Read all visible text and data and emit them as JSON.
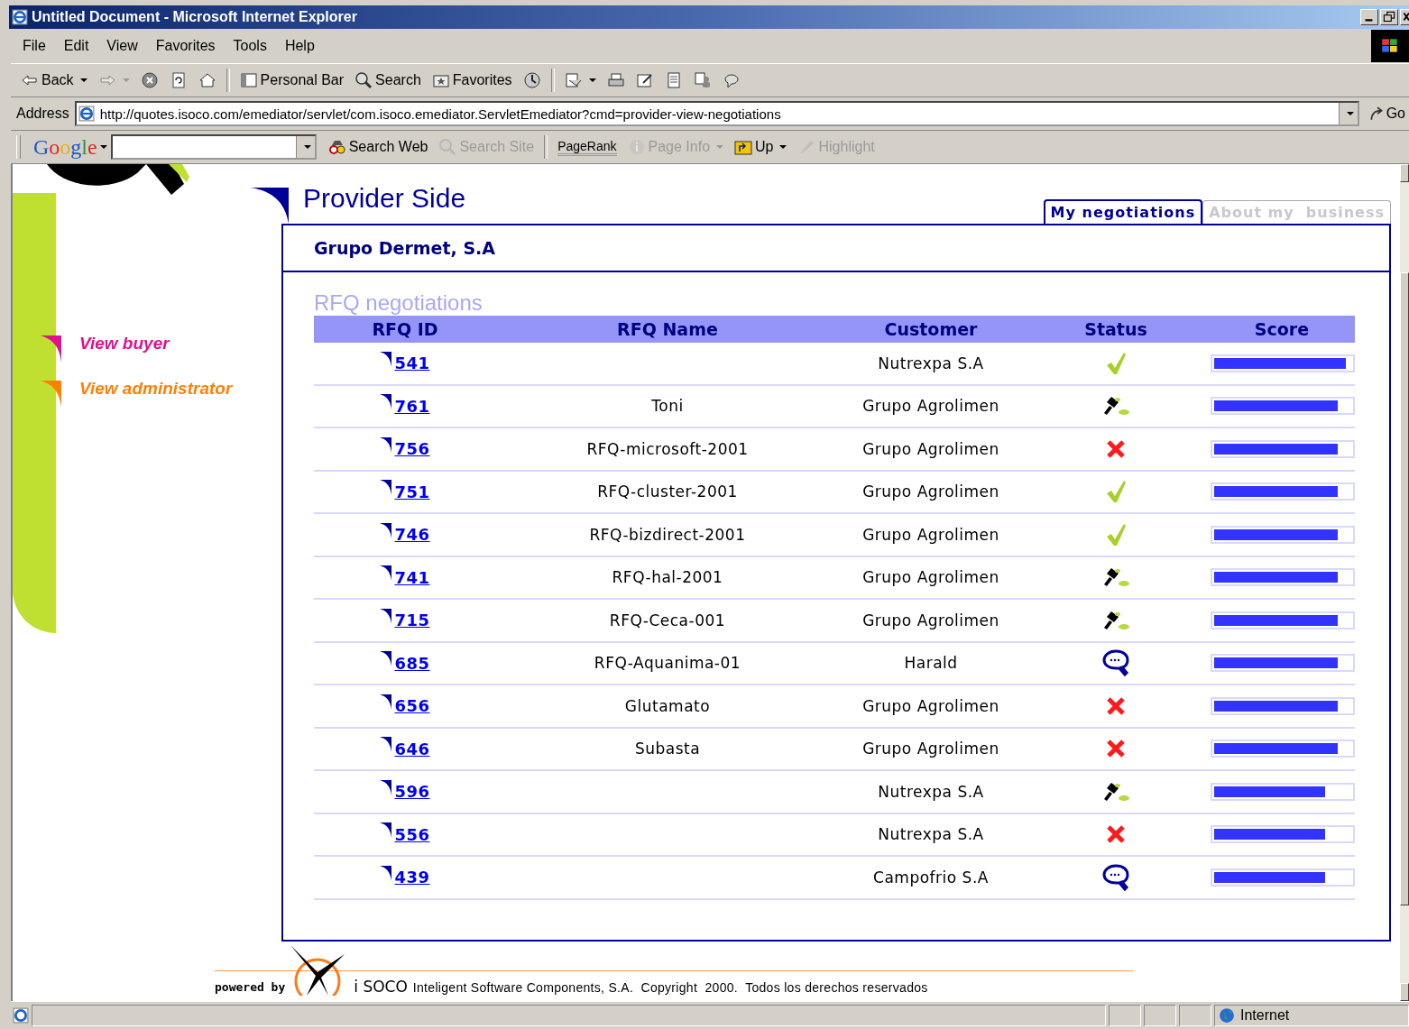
{
  "window": {
    "title": "Untitled Document - Microsoft Internet Explorer"
  },
  "menu": [
    "File",
    "Edit",
    "View",
    "Favorites",
    "Tools",
    "Help"
  ],
  "toolbar": {
    "groups": [
      [
        {
          "kind": "back",
          "label": "Back",
          "dropdown": true,
          "disabled": false
        },
        {
          "kind": "forward",
          "dropdown": true,
          "disabled": true
        },
        {
          "kind": "stop",
          "dropdown": false,
          "disabled": false
        },
        {
          "kind": "refresh",
          "dropdown": false,
          "disabled": false
        },
        {
          "kind": "home",
          "dropdown": false,
          "disabled": false
        }
      ],
      [
        {
          "kind": "personal-bar",
          "label": "Personal Bar",
          "dropdown": false,
          "disabled": false
        },
        {
          "kind": "search",
          "label": "Search",
          "dropdown": false,
          "disabled": false
        },
        {
          "kind": "favorites",
          "label": "Favorites",
          "dropdown": false,
          "disabled": false
        },
        {
          "kind": "history",
          "dropdown": false,
          "disabled": false
        }
      ],
      [
        {
          "kind": "mail",
          "dropdown": true,
          "disabled": false
        },
        {
          "kind": "print",
          "dropdown": false,
          "disabled": false
        },
        {
          "kind": "edit",
          "dropdown": false,
          "disabled": false
        },
        {
          "kind": "discuss",
          "dropdown": false,
          "disabled": false
        },
        {
          "kind": "messenger",
          "dropdown": false,
          "disabled": false
        },
        {
          "kind": "chat",
          "dropdown": false,
          "disabled": false
        }
      ]
    ]
  },
  "address": {
    "label": "Address",
    "url": "http://quotes.isoco.com/emediator/servlet/com.isoco.emediator.ServletEmediator?cmd=provider-view-negotiations",
    "go": "Go"
  },
  "google_bar": {
    "logo": "Google",
    "items": [
      {
        "kind": "search-web",
        "label": "Search Web",
        "dropdown": false,
        "disabled": false
      },
      {
        "kind": "search-site",
        "label": "Search Site",
        "dropdown": false,
        "disabled": true
      },
      {
        "kind": "pagerank",
        "label": "PageRank",
        "dropdown": false,
        "disabled": false
      },
      {
        "kind": "page-info",
        "label": "Page Info",
        "dropdown": true,
        "disabled": true
      },
      {
        "kind": "up",
        "label": "Up",
        "dropdown": true,
        "disabled": false
      },
      {
        "kind": "highlight",
        "label": "Highlight",
        "dropdown": false,
        "disabled": true
      }
    ]
  },
  "sidebar": {
    "links": [
      {
        "label": "View buyer",
        "color": "#e0108f"
      },
      {
        "label": "View administrator",
        "color": "#ff8000"
      }
    ]
  },
  "page": {
    "title": "Provider Side",
    "tabs": [
      {
        "label": "My negotiations",
        "selected": true
      },
      {
        "label": "About my  business",
        "selected": false
      }
    ],
    "company": "Grupo Dermet, S.A",
    "section": "RFQ negotiations",
    "table": {
      "columns": [
        "RFQ ID",
        "RFQ Name",
        "Customer",
        "Status",
        "Score"
      ],
      "rows": [
        {
          "id": "541",
          "name": "",
          "customer": "Nutrexpa S.A",
          "kind": "check",
          "level": 0.96
        },
        {
          "id": "761",
          "name": "Toni",
          "customer": "Grupo Agrolimen",
          "kind": "gavel",
          "level": 0.9
        },
        {
          "id": "756",
          "name": "RFQ-microsoft-2001",
          "customer": "Grupo Agrolimen",
          "kind": "cross",
          "level": 0.9
        },
        {
          "id": "751",
          "name": "RFQ-cluster-2001",
          "customer": "Grupo Agrolimen",
          "kind": "check",
          "level": 0.9
        },
        {
          "id": "746",
          "name": "RFQ-bizdirect-2001",
          "customer": "Grupo Agrolimen",
          "kind": "check",
          "level": 0.9
        },
        {
          "id": "741",
          "name": "RFQ-hal-2001",
          "customer": "Grupo Agrolimen",
          "kind": "gavel",
          "level": 0.9
        },
        {
          "id": "715",
          "name": "RFQ-Ceca-001",
          "customer": "Grupo Agrolimen",
          "kind": "gavel",
          "level": 0.9
        },
        {
          "id": "685",
          "name": "RFQ-Aquanima-01",
          "customer": "Harald",
          "kind": "chat",
          "level": 0.9
        },
        {
          "id": "656",
          "name": "Glutamato",
          "customer": "Grupo Agrolimen",
          "kind": "cross",
          "level": 0.9
        },
        {
          "id": "646",
          "name": "Subasta",
          "customer": "Grupo Agrolimen",
          "kind": "cross",
          "level": 0.9
        },
        {
          "id": "596",
          "name": "",
          "customer": "Nutrexpa S.A",
          "kind": "gavel",
          "level": 0.81
        },
        {
          "id": "556",
          "name": "",
          "customer": "Nutrexpa S.A",
          "kind": "cross",
          "level": 0.81
        },
        {
          "id": "439",
          "name": "",
          "customer": "Campofrio S.A",
          "kind": "chat",
          "level": 0.81
        }
      ]
    }
  },
  "footer": {
    "powered_by": "powered by",
    "brand": "i SOCO",
    "text": "Inteligent Software Components, S.A.  Copyright  2000.  Todos los derechos reservados"
  },
  "status_bar": {
    "zone": "Internet"
  }
}
